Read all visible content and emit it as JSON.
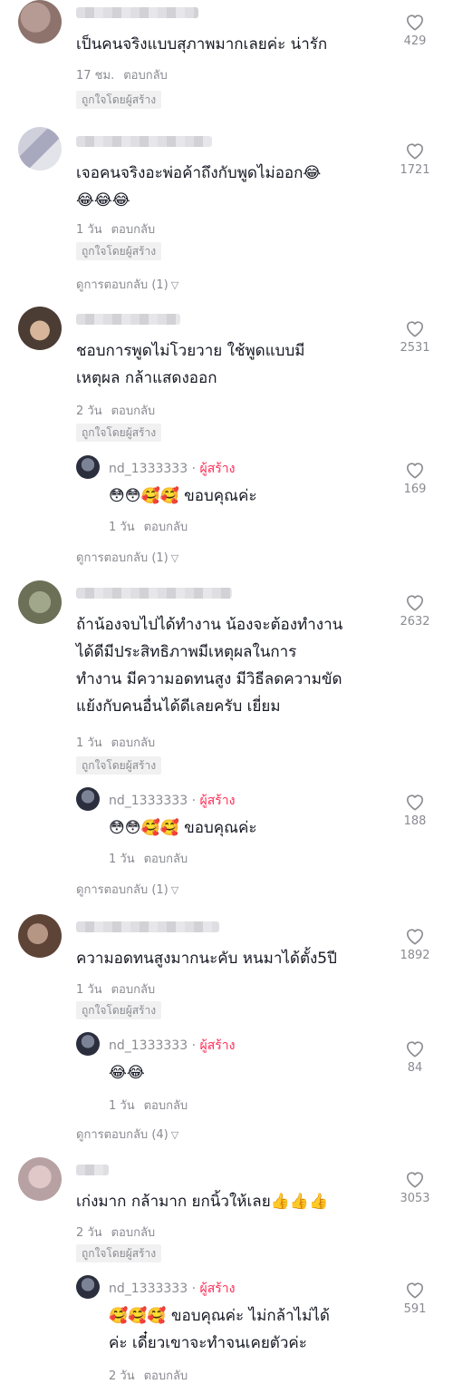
{
  "comments": [
    {
      "text": "เป็นคนจริงแบบสุภาพมากเลยค่ะ น่ารัก",
      "time": "17 ชม.",
      "reply": "ตอบกลับ",
      "liked_by_creator": "ถูกใจโดยผู้สร้าง",
      "likes": "429"
    },
    {
      "text": "เจอคนจริงอะพ่อค้าถึงกับพูดไม่ออก😂\n😂😂😂",
      "time": "1 วัน",
      "reply": "ตอบกลับ",
      "liked_by_creator": "ถูกใจโดยผู้สร้าง",
      "view_replies": "ดูการตอบกลับ (1)",
      "likes": "1721"
    },
    {
      "text": "ชอบการพูดไม่โวยวาย ใช้พูดแบบมี\nเหตุผล กล้าแสดงออก",
      "time": "2 วัน",
      "reply": "ตอบกลับ",
      "liked_by_creator": "ถูกใจโดยผู้สร้าง",
      "view_replies": "ดูการตอบกลับ (1)",
      "likes": "2531",
      "creator_reply": {
        "username": "nd_1333333",
        "role": "ผู้สร้าง",
        "text": "😳😳🥰🥰 ขอบคุณค่ะ",
        "time": "1 วัน",
        "reply": "ตอบกลับ",
        "likes": "169"
      }
    },
    {
      "text": "ถ้าน้องจบไปได้ทำงาน น้องจะต้องทำงาน\nได้ดีมีประสิทธิภาพมีเหตุผลในการ\nทำงาน มีความอดทนสูง มีวิธีลดความขัด\nแย้งกับคนอื่นได้ดีเลยครับ เยี่ยม",
      "time": "1 วัน",
      "reply": "ตอบกลับ",
      "liked_by_creator": "ถูกใจโดยผู้สร้าง",
      "view_replies": "ดูการตอบกลับ (1)",
      "likes": "2632",
      "creator_reply": {
        "username": "nd_1333333",
        "role": "ผู้สร้าง",
        "text": "😳😳🥰🥰 ขอบคุณค่ะ",
        "time": "1 วัน",
        "reply": "ตอบกลับ",
        "likes": "188"
      }
    },
    {
      "text": "ความอดทนสูงมากนะคับ หนมาได้ตั้ง5ปี",
      "time": "1 วัน",
      "reply": "ตอบกลับ",
      "liked_by_creator": "ถูกใจโดยผู้สร้าง",
      "view_replies": "ดูการตอบกลับ (4)",
      "likes": "1892",
      "creator_reply": {
        "username": "nd_1333333",
        "role": "ผู้สร้าง",
        "text": "😂😂",
        "time": "1 วัน",
        "reply": "ตอบกลับ",
        "likes": "84"
      }
    },
    {
      "text": "เก่งมาก กล้ามาก ยกนิ้วให้เลย👍👍👍",
      "time": "2 วัน",
      "reply": "ตอบกลับ",
      "liked_by_creator": "ถูกใจโดยผู้สร้าง",
      "likes": "3053",
      "creator_reply": {
        "username": "nd_1333333",
        "role": "ผู้สร้าง",
        "text": "🥰🥰🥰 ขอบคุณค่ะ ไม่กล้าไม่ได้\nค่ะ เดี๋ยวเขาจะทำจนเคยตัวค่ะ",
        "time": "2 วัน",
        "reply": "ตอบกลับ",
        "likes": "591"
      }
    }
  ]
}
